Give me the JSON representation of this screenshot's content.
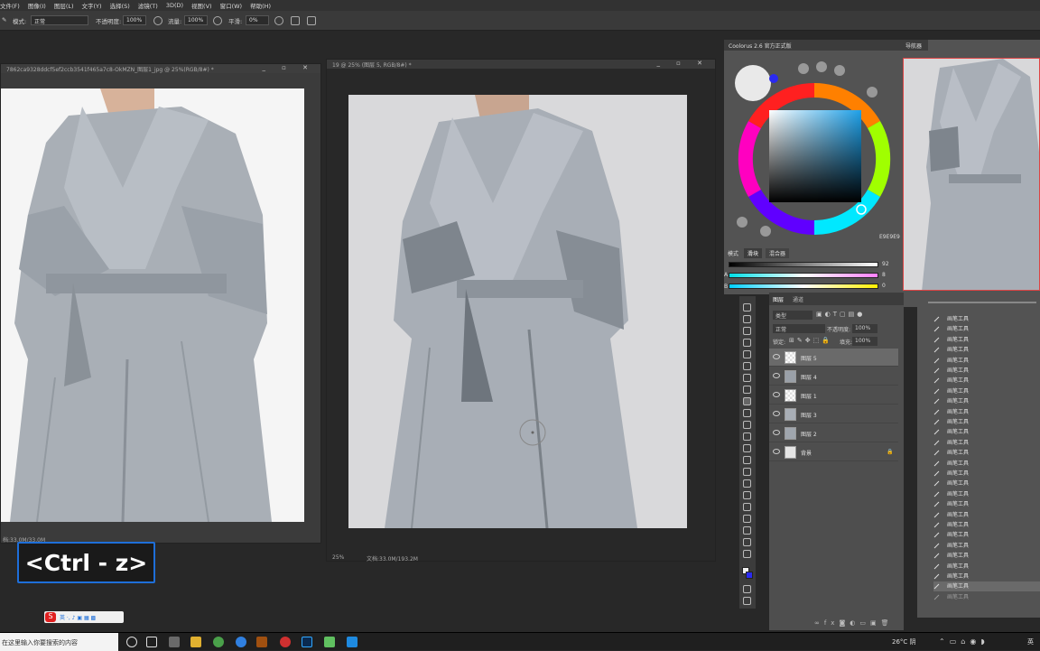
{
  "menubar": {
    "items": [
      "文件(F)",
      "图像(I)",
      "图层(L)",
      "文字(Y)",
      "选择(S)",
      "滤镜(T)",
      "3D(D)",
      "视图(V)",
      "窗口(W)",
      "帮助(H)"
    ],
    "trailing": "帮助(H)"
  },
  "options": {
    "mode_label": "模式:",
    "mode_value": "正常",
    "opacity_label": "不透明度:",
    "opacity_value": "100%",
    "flow_label": "流量:",
    "flow_value": "100%",
    "smooth_label": "平滑:",
    "smooth_value": "0%"
  },
  "doc_left": {
    "title": "7862ca9328ddcf5ef2ccb3541f465a7c8-OkMZN_图层1_jpg @ 25%(RGB/8#) *",
    "status": "档:33.0M/33.0M"
  },
  "doc_main": {
    "title": "19 @ 25% (图层 5, RGB/8#) *",
    "zoom": "25%",
    "status": "文档:33.0M/193.2M"
  },
  "coolorus": {
    "title": "Coolorus 2.6 官方正式版",
    "hex": "E9E9E9",
    "tabs": [
      "模式",
      "滑块",
      "混合器"
    ],
    "slider_values": [
      "92",
      "8",
      "0"
    ],
    "slider_labels": [
      "",
      "A",
      "B"
    ]
  },
  "navigator": {
    "tab": "导航器"
  },
  "layers_panel": {
    "tabs": [
      "图层",
      "通道"
    ],
    "kind": "类型",
    "blend": "正常",
    "opacity_label": "不透明度:",
    "opacity_value": "100%",
    "lock_label": "锁定:",
    "fill_label": "填充:",
    "fill_value": "100%",
    "layers": [
      {
        "name": "图层 5",
        "selected": true
      },
      {
        "name": "图层 4",
        "selected": false
      },
      {
        "name": "图层 1",
        "selected": false
      },
      {
        "name": "图层 3",
        "selected": false
      },
      {
        "name": "图层 2",
        "selected": false
      },
      {
        "name": "背景",
        "selected": false
      }
    ]
  },
  "history": {
    "item_label": "画笔工具",
    "count": 28
  },
  "shortcut_overlay": "<Ctrl - z>",
  "taskbar": {
    "search_placeholder": "在这里输入你要搜索的内容",
    "weather": "26°C 阴",
    "ime": "英"
  },
  "colors": {
    "accent": "#1e6fd9",
    "panel_bg": "#535353",
    "canvas_bg": "#282828",
    "coat": "#a9b0b8"
  }
}
